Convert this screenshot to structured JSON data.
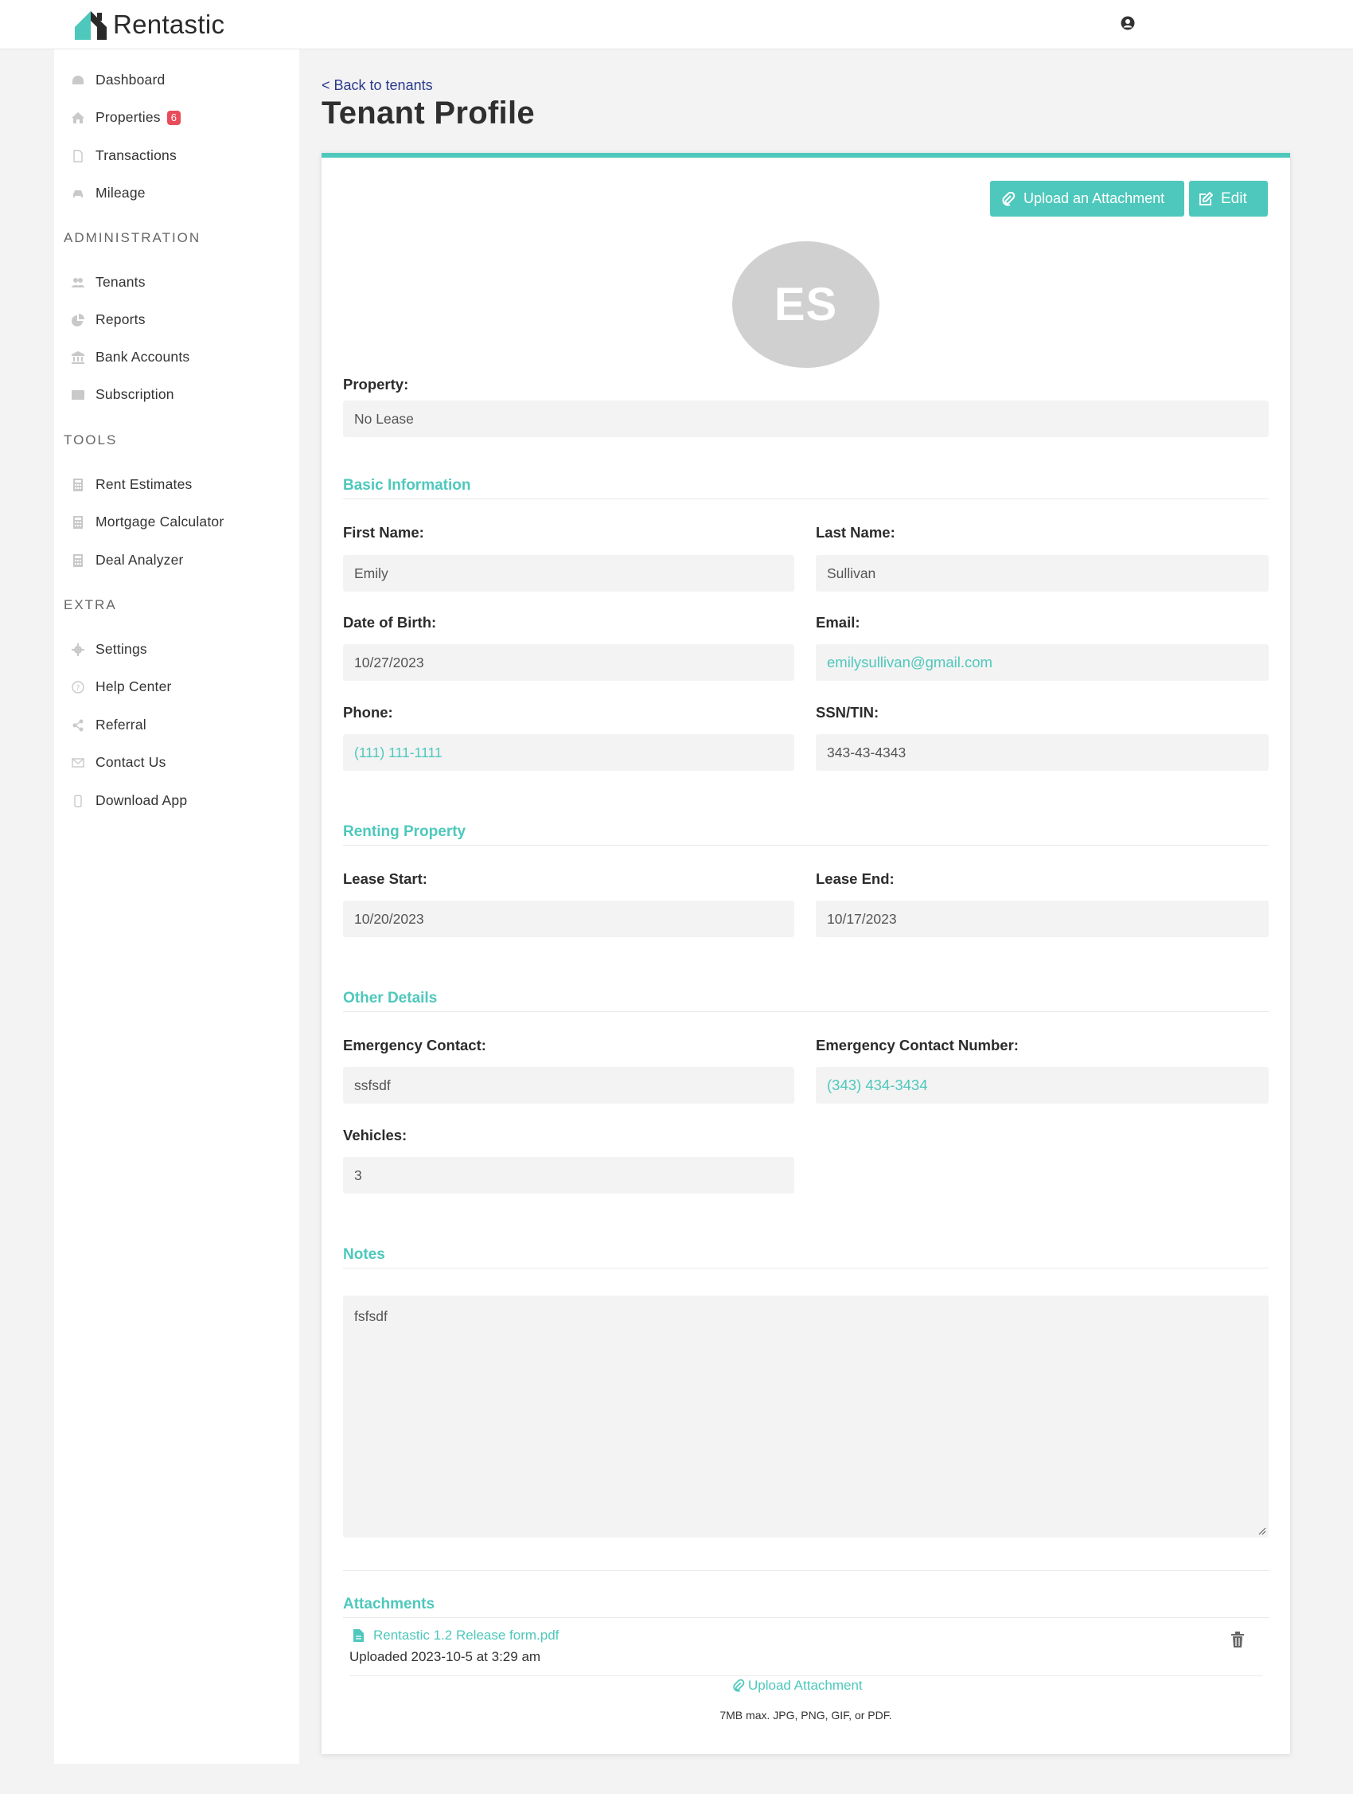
{
  "brand": {
    "name": "Rentastic",
    "accent": "#4ec8bc"
  },
  "sidebar": {
    "main": [
      {
        "label": "Dashboard",
        "icon": "dashboard-icon"
      },
      {
        "label": "Properties",
        "icon": "home-icon",
        "badge": "6"
      },
      {
        "label": "Transactions",
        "icon": "file-icon"
      },
      {
        "label": "Mileage",
        "icon": "car-icon"
      }
    ],
    "administration_title": "ADMINISTRATION",
    "administration": [
      {
        "label": "Tenants",
        "icon": "users-icon"
      },
      {
        "label": "Reports",
        "icon": "pie-chart-icon"
      },
      {
        "label": "Bank Accounts",
        "icon": "bank-icon"
      },
      {
        "label": "Subscription",
        "icon": "card-icon"
      }
    ],
    "tools_title": "TOOLS",
    "tools": [
      {
        "label": "Rent Estimates",
        "icon": "calculator-icon"
      },
      {
        "label": "Mortgage Calculator",
        "icon": "calculator-icon"
      },
      {
        "label": "Deal Analyzer",
        "icon": "calculator-icon"
      }
    ],
    "extra_title": "EXTRA",
    "extra": [
      {
        "label": "Settings",
        "icon": "gear-icon"
      },
      {
        "label": "Help Center",
        "icon": "help-icon"
      },
      {
        "label": "Referral",
        "icon": "share-icon"
      },
      {
        "label": "Contact Us",
        "icon": "envelope-icon"
      },
      {
        "label": "Download App",
        "icon": "phone-icon"
      }
    ]
  },
  "header": {
    "back_link": "< Back to tenants",
    "title": "Tenant Profile"
  },
  "actions": {
    "upload": "Upload an Attachment",
    "edit": "Edit"
  },
  "profile": {
    "initials": "ES",
    "property_label": "Property:",
    "property_value": "No Lease"
  },
  "basic": {
    "title": "Basic Information",
    "first_name_label": "First Name:",
    "first_name": "Emily",
    "last_name_label": "Last Name:",
    "last_name": "Sullivan",
    "dob_label": "Date of Birth:",
    "dob": "10/27/2023",
    "email_label": "Email:",
    "email": "emilysullivan@gmail.com",
    "phone_label": "Phone:",
    "phone": "(111) 111-1111",
    "ssn_label": "SSN/TIN:",
    "ssn": "343-43-4343"
  },
  "renting": {
    "title": "Renting Property",
    "lease_start_label": "Lease Start:",
    "lease_start": "10/20/2023",
    "lease_end_label": "Lease End:",
    "lease_end": "10/17/2023"
  },
  "other": {
    "title": "Other Details",
    "emergency_contact_label": "Emergency Contact:",
    "emergency_contact": "ssfsdf",
    "emergency_number_label": "Emergency Contact Number:",
    "emergency_number": "(343) 434-3434",
    "vehicles_label": "Vehicles:",
    "vehicles": "3"
  },
  "notes": {
    "title": "Notes",
    "value": "fsfsdf"
  },
  "attachments": {
    "title": "Attachments",
    "file_name": "Rentastic 1.2 Release form.pdf",
    "uploaded": "Uploaded 2023-10-5 at 3:29 am",
    "upload_link": "Upload Attachment",
    "hint": "7MB max. JPG, PNG, GIF, or PDF."
  }
}
